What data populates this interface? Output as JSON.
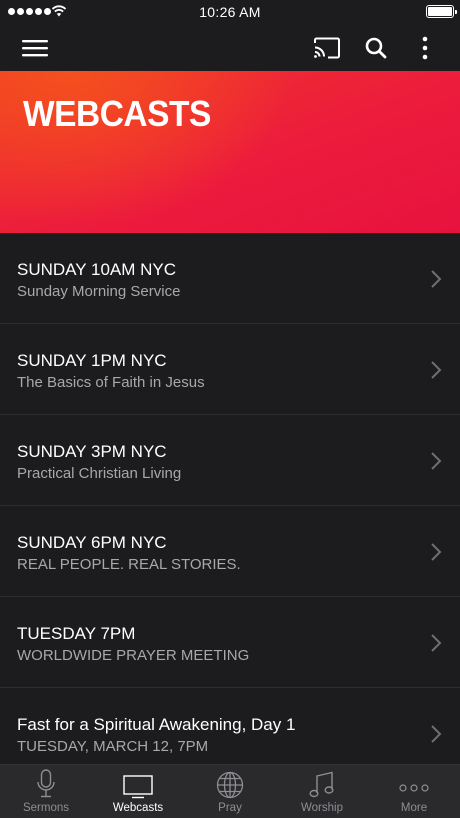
{
  "status_bar": {
    "time": "10:26 AM"
  },
  "hero": {
    "title": "WEBCASTS"
  },
  "webcasts": [
    {
      "title": "SUNDAY 10AM NYC",
      "subtitle": "Sunday Morning Service"
    },
    {
      "title": "SUNDAY 1PM NYC",
      "subtitle": "The Basics of Faith in Jesus"
    },
    {
      "title": "SUNDAY 3PM NYC",
      "subtitle": "Practical Christian Living"
    },
    {
      "title": "SUNDAY 6PM NYC",
      "subtitle": "REAL PEOPLE. REAL STORIES."
    },
    {
      "title": "TUESDAY 7PM",
      "subtitle": "WORLDWIDE PRAYER MEETING"
    },
    {
      "title": "Fast for a Spiritual Awakening, Day 1",
      "subtitle": "TUESDAY, MARCH 12, 7PM"
    }
  ],
  "tabs": [
    {
      "label": "Sermons",
      "icon": "microphone-icon"
    },
    {
      "label": "Webcasts",
      "icon": "tv-icon",
      "active": true
    },
    {
      "label": "Pray",
      "icon": "globe-icon"
    },
    {
      "label": "Worship",
      "icon": "music-note-icon"
    },
    {
      "label": "More",
      "icon": "more-dots-icon"
    }
  ],
  "colors": {
    "background": "#1c1c1e",
    "accent_red": "#ec1c3c",
    "accent_orange": "#f5501e",
    "tab_bar": "#2a2a2d"
  }
}
